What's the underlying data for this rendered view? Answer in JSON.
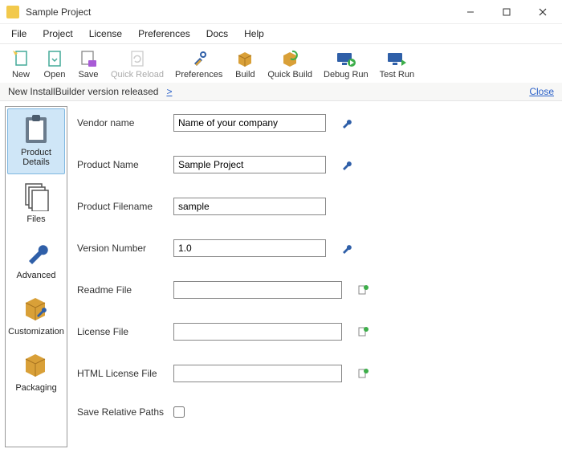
{
  "window": {
    "title": "Sample Project"
  },
  "menu": {
    "file": "File",
    "project": "Project",
    "license": "License",
    "preferences": "Preferences",
    "docs": "Docs",
    "help": "Help"
  },
  "toolbar": {
    "new": "New",
    "open": "Open",
    "save": "Save",
    "quick_reload": "Quick Reload",
    "preferences": "Preferences",
    "build": "Build",
    "quick_build": "Quick Build",
    "debug_run": "Debug Run",
    "test_run": "Test Run"
  },
  "notify": {
    "text": "New InstallBuilder version released",
    "more": ">",
    "close": "Close"
  },
  "sidebar": {
    "items": [
      {
        "label": "Product Details"
      },
      {
        "label": "Files"
      },
      {
        "label": "Advanced"
      },
      {
        "label": "Customization"
      },
      {
        "label": "Packaging"
      }
    ]
  },
  "form": {
    "vendor_name": {
      "label": "Vendor name",
      "value": "Name of your company"
    },
    "product_name": {
      "label": "Product Name",
      "value": "Sample Project"
    },
    "product_filename": {
      "label": "Product Filename",
      "value": "sample"
    },
    "version_number": {
      "label": "Version Number",
      "value": "1.0"
    },
    "readme_file": {
      "label": "Readme File",
      "value": ""
    },
    "license_file": {
      "label": "License File",
      "value": ""
    },
    "html_license_file": {
      "label": "HTML License File",
      "value": ""
    },
    "save_relative_paths": {
      "label": "Save Relative Paths",
      "checked": false
    }
  }
}
